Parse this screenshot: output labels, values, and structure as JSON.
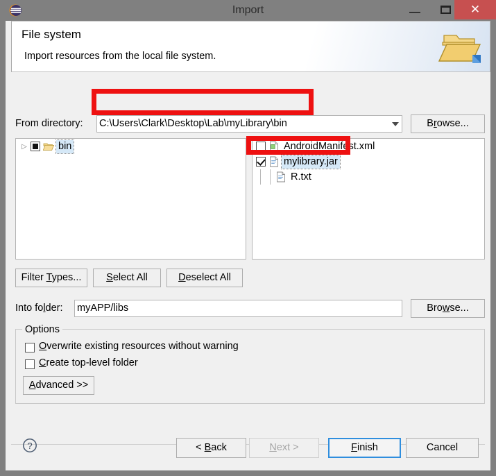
{
  "window": {
    "title": "Import",
    "app_icon": "eclipse-icon",
    "controls": {
      "minimize": "–",
      "maximize": "□",
      "close": "✕",
      "close_bg": "#c75050"
    },
    "titlebar_bg": "#808080"
  },
  "banner": {
    "title": "File system",
    "subtitle": "Import resources from the local file system.",
    "icon": "open-folder-import-icon"
  },
  "source": {
    "label": "From directory:",
    "label_mnemonic": "",
    "value": "C:\\Users\\Clark\\Desktop\\Lab\\myLibrary\\bin",
    "placeholder": "",
    "browse_label_pre": "B",
    "browse_label_mnemonic": "r",
    "browse_label_post": "owse..."
  },
  "tree": {
    "nodes": [
      {
        "label": "bin",
        "checkbox_state": "partial",
        "expanded": false,
        "icon": "folder-open-icon",
        "selected": true
      }
    ]
  },
  "files": {
    "items": [
      {
        "label": "AndroidManifest.xml",
        "checked": false,
        "icon": "xml-file-icon",
        "selected": false
      },
      {
        "label": "mylibrary.jar",
        "checked": true,
        "icon": "file-icon",
        "selected": true
      },
      {
        "label": "R.txt",
        "checked": false,
        "icon": "file-icon",
        "selected": false
      }
    ]
  },
  "selection_buttons": {
    "filter_types_pre": "Filter ",
    "filter_types_mnemonic": "T",
    "filter_types_post": "ypes...",
    "select_all_mnemonic": "S",
    "select_all_post": "elect All",
    "deselect_all_mnemonic": "D",
    "deselect_all_post": "eselect All"
  },
  "destination": {
    "label_pre": "Into fo",
    "label_mnemonic": "l",
    "label_post": "der:",
    "value": "myAPP/libs",
    "placeholder": "",
    "browse_label_pre": "Bro",
    "browse_label_mnemonic": "w",
    "browse_label_post": "se..."
  },
  "options": {
    "group_title": "Options",
    "checkboxes": [
      {
        "mnemonic": "O",
        "rest": "verwrite existing resources without warning",
        "checked": false
      },
      {
        "mnemonic": "C",
        "rest": "reate top-level folder",
        "checked": false
      }
    ],
    "advanced_mnemonic": "A",
    "advanced_post": "dvanced >>"
  },
  "footer": {
    "help_icon": "help-question-icon",
    "buttons": [
      {
        "name": "back",
        "pre": "< ",
        "mnemonic": "B",
        "post": "ack",
        "enabled": true,
        "default": false
      },
      {
        "name": "next",
        "pre": "",
        "mnemonic": "N",
        "post": "ext >",
        "enabled": false,
        "default": false
      },
      {
        "name": "finish",
        "pre": "",
        "mnemonic": "F",
        "post": "inish",
        "enabled": true,
        "default": true
      },
      {
        "name": "cancel",
        "pre": "Cancel",
        "mnemonic": "",
        "post": "",
        "enabled": true,
        "default": false
      }
    ]
  },
  "annotations": {
    "accent_color": "#ee1111",
    "boxes": [
      {
        "name": "directory-path-highlight"
      },
      {
        "name": "mylibrary-jar-highlight"
      }
    ]
  }
}
